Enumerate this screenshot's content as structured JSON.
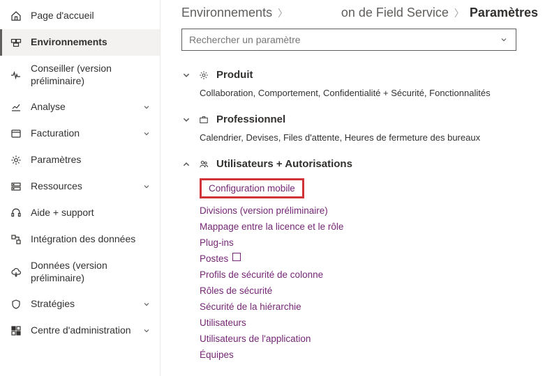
{
  "sidebar": {
    "items": [
      {
        "label": "Page d'accueil"
      },
      {
        "label": "Environnements"
      },
      {
        "label": "Conseiller (version préliminaire)"
      },
      {
        "label": "Analyse"
      },
      {
        "label": "Facturation"
      },
      {
        "label": "Paramètres"
      },
      {
        "label": "Ressources"
      },
      {
        "label": "Aide + support"
      },
      {
        "label": "Intégration des données"
      },
      {
        "label": "Données (version préliminaire)"
      },
      {
        "label": "Stratégies"
      },
      {
        "label": "Centre d'administration"
      }
    ]
  },
  "breadcrumb": {
    "item1": "Environnements",
    "item2": "on de Field Service",
    "item3": "Paramètres"
  },
  "search": {
    "placeholder": "Rechercher un paramètre"
  },
  "sections": {
    "product": {
      "title": "Produit",
      "desc": "Collaboration, Comportement, Confidentialité + Sécurité, Fonctionnalités"
    },
    "professional": {
      "title": "Professionnel",
      "desc": "Calendrier, Devises, Files d'attente, Heures de fermeture des bureaux"
    },
    "users": {
      "title": "Utilisateurs + Autorisations",
      "items": {
        "mobile": "Configuration mobile",
        "divisions": "Divisions (version préliminaire)",
        "mapping": "Mappage entre la licence et le rôle",
        "plugins": "Plug-ins",
        "postes": "Postes",
        "colsec": "Profils de sécurité de colonne",
        "roles": "Rôles de sécurité",
        "hierarchy": "Sécurité de la hiérarchie",
        "users": "Utilisateurs",
        "appusers": "Utilisateurs de l'application",
        "teams": "Équipes"
      }
    }
  }
}
